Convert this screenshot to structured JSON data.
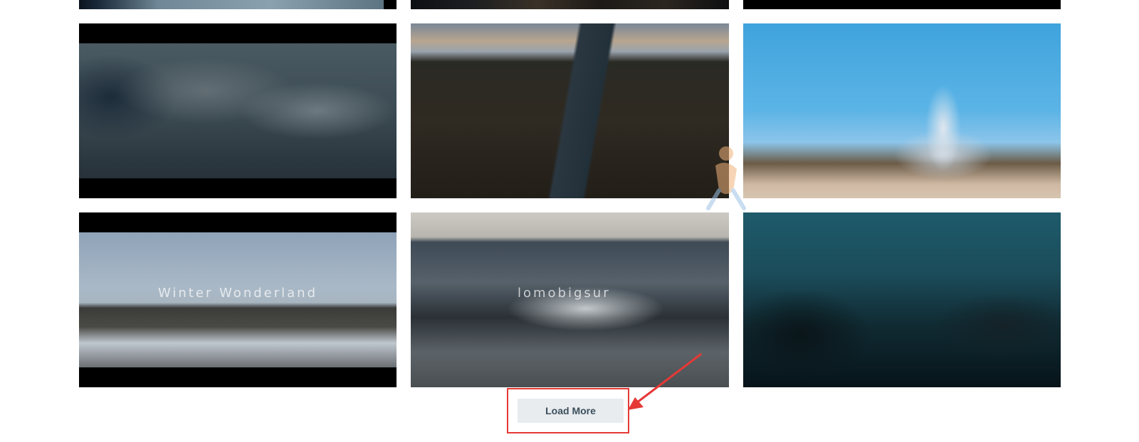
{
  "gallery": {
    "tiles": [
      {
        "caption": ""
      },
      {
        "caption": ""
      },
      {
        "caption": ""
      },
      {
        "caption": ""
      },
      {
        "caption": ""
      },
      {
        "caption": ""
      },
      {
        "caption": "Winter Wonderland"
      },
      {
        "caption": "lomobigsur"
      },
      {
        "caption": ""
      }
    ]
  },
  "actions": {
    "load_more_label": "Load More"
  },
  "annotation": {
    "highlight_color": "#e53935"
  },
  "colors": {
    "button_bg": "#e8ecef",
    "button_text": "#3b4f5c"
  }
}
